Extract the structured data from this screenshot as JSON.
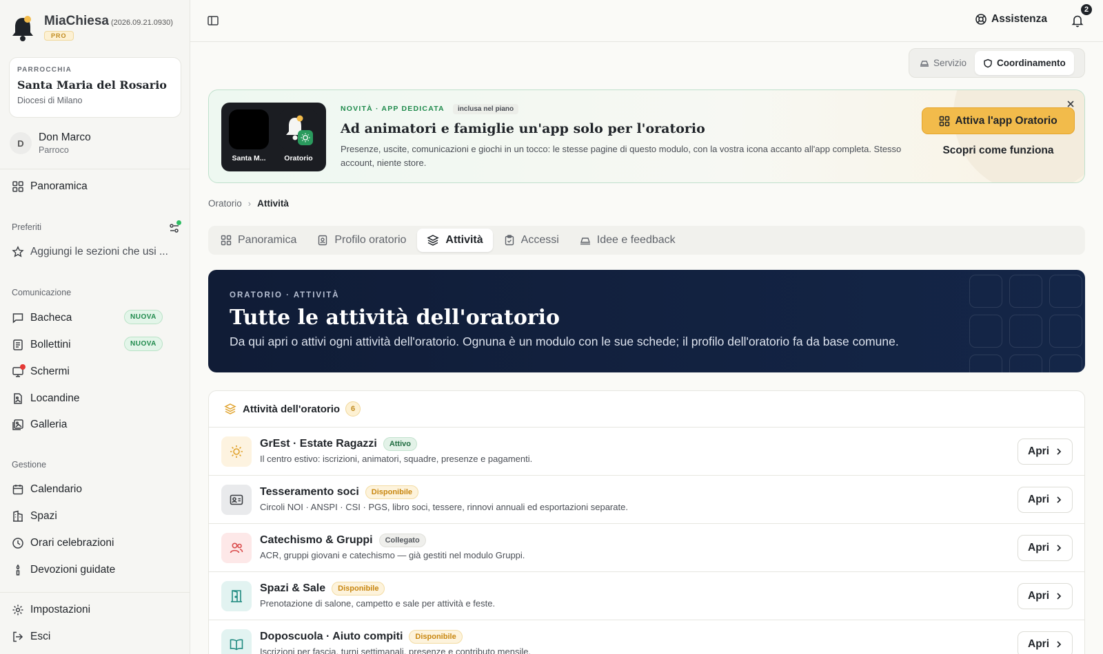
{
  "brand": {
    "name": "MiaChiesa",
    "version": "(2026.09.21.0930)",
    "plan": "PRO"
  },
  "parish": {
    "kicker": "PARROCCHIA",
    "name": "Santa Maria del Rosario",
    "diocese": "Diocesi di Milano"
  },
  "user": {
    "initial": "D",
    "name": "Don Marco",
    "role": "Parroco"
  },
  "sidebar": {
    "overview": "Panoramica",
    "favorites": {
      "title": "Preferiti",
      "add_label": "Aggiungi le sezioni che usi ..."
    },
    "communication": {
      "title": "Comunicazione",
      "items": [
        {
          "label": "Bacheca",
          "badge": "NUOVA",
          "icon": "message-square-icon"
        },
        {
          "label": "Bollettini",
          "badge": "NUOVA",
          "icon": "newspaper-icon"
        },
        {
          "label": "Schermi",
          "icon": "monitor-icon"
        },
        {
          "label": "Locandine",
          "icon": "file-image-icon"
        },
        {
          "label": "Galleria",
          "icon": "images-icon"
        }
      ]
    },
    "management": {
      "title": "Gestione",
      "items": [
        {
          "label": "Calendario",
          "icon": "calendar-icon"
        },
        {
          "label": "Spazi",
          "icon": "building-icon"
        },
        {
          "label": "Orari celebrazioni",
          "icon": "clock-icon"
        },
        {
          "label": "Devozioni guidate",
          "icon": "candle-icon"
        }
      ]
    },
    "settings": "Impostazioni",
    "logout": "Esci"
  },
  "topbar": {
    "help": "Assistenza",
    "notifications_count": "2"
  },
  "mode_switch": {
    "service": "Servizio",
    "coordination": "Coordinamento",
    "active": "coordination"
  },
  "promo": {
    "kicker": "NOVITÀ · APP DEDICATA",
    "included": "inclusa nel piano",
    "title": "Ad animatori e famiglie un'app solo per l'oratorio",
    "text": "Presenze, uscite, comunicazioni e giochi in un tocco: le stesse pagine di questo modulo, con la vostra icona accanto all'app completa. Stesso account, niente store.",
    "cta": "Attiva l'app Oratorio",
    "link": "Scopri come funziona",
    "tile_parish": "Santa M...",
    "tile_oratorio": "Oratorio"
  },
  "breadcrumb": {
    "parent": "Oratorio",
    "current": "Attività"
  },
  "tabs": [
    {
      "label": "Panoramica",
      "icon": "grid-icon"
    },
    {
      "label": "Profilo oratorio",
      "icon": "id-badge-icon"
    },
    {
      "label": "Attività",
      "icon": "layers-icon",
      "active": true
    },
    {
      "label": "Accessi",
      "icon": "clipboard-icon"
    },
    {
      "label": "Idee e feedback",
      "icon": "megaphone-icon"
    }
  ],
  "hero": {
    "kicker": "ORATORIO · ATTIVITÀ",
    "title": "Tutte le attività dell'oratorio",
    "text": "Da qui apri o attivi ogni attività dell'oratorio. Ognuna è un modulo con le sue schede; il profilo dell'oratorio fa da base comune."
  },
  "activities": {
    "title": "Attività dell'oratorio",
    "count": "6",
    "open_label": "Apri",
    "items": [
      {
        "title": "GrEst · Estate Ragazzi",
        "status": "Attivo",
        "status_kind": "green",
        "desc": "Il centro estivo: iscrizioni, animatori, squadre, presenze e pagamenti.",
        "icon": "sun-icon",
        "icon_bg": "#fdf3e0",
        "icon_color": "#e0a12a"
      },
      {
        "title": "Tesseramento soci",
        "status": "Disponibile",
        "status_kind": "amber",
        "desc": "Circoli NOI · ANSPI · CSI · PGS, libro soci, tessere, rinnovi annuali ed esportazioni separate.",
        "icon": "id-card-icon",
        "icon_bg": "#e9eaec",
        "icon_color": "#3a3d42"
      },
      {
        "title": "Catechismo & Gruppi",
        "status": "Collegato",
        "status_kind": "gray",
        "desc": "ACR, gruppi giovani e catechismo — già gestiti nel modulo Gruppi.",
        "icon": "users-icon",
        "icon_bg": "#fde8e8",
        "icon_color": "#d94a4a"
      },
      {
        "title": "Spazi & Sale",
        "status": "Disponibile",
        "status_kind": "amber",
        "desc": "Prenotazione di salone, campetto e sale per attività e feste.",
        "icon": "door-icon",
        "icon_bg": "#e2f3f1",
        "icon_color": "#1f8a80"
      },
      {
        "title": "Doposcuola · Aiuto compiti",
        "status": "Disponibile",
        "status_kind": "amber",
        "desc": "Iscrizioni per fascia, turni settimanali, presenze e contributo mensile.",
        "icon": "book-open-icon",
        "icon_bg": "#e2f3f1",
        "icon_color": "#1f8a80"
      }
    ]
  }
}
